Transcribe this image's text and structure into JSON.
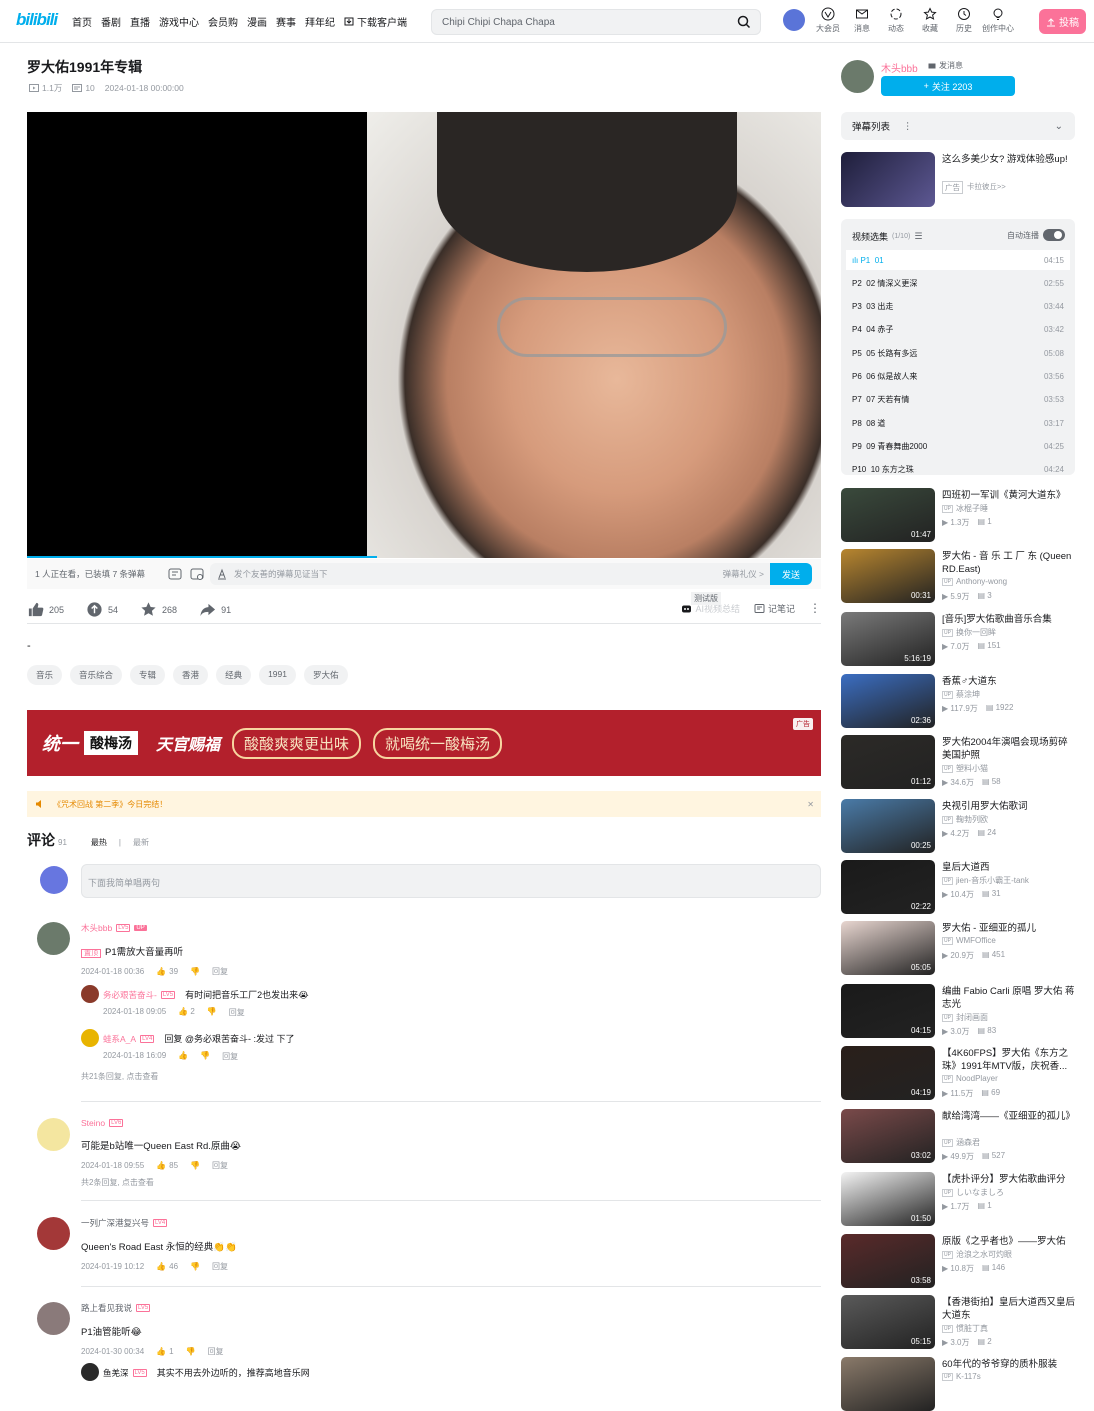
{
  "header": {
    "logo": "bilibili",
    "nav": [
      "首页",
      "番剧",
      "直播",
      "游戏中心",
      "会员购",
      "漫画",
      "赛事",
      "拜年纪"
    ],
    "download": "下载客户端",
    "search_placeholder": "Chipi Chipi Chapa Chapa",
    "icons": [
      {
        "label": "大会员",
        "icon": "vip-icon"
      },
      {
        "label": "消息",
        "icon": "message-icon"
      },
      {
        "label": "动态",
        "icon": "dynamic-icon"
      },
      {
        "label": "收藏",
        "icon": "star-icon"
      },
      {
        "label": "历史",
        "icon": "history-icon"
      },
      {
        "label": "创作中心",
        "icon": "bulb-icon"
      }
    ],
    "upload": "投稿"
  },
  "video": {
    "title": "罗大佑1991年专辑",
    "views": "1.1万",
    "danmaku": "10",
    "date": "2024-01-18 00:00:00",
    "watching": "1 人正在看，已装填 7 条弹幕",
    "danmu_placeholder": "发个友善的弹幕见证当下",
    "danmu_etiquette": "弹幕礼仪 >",
    "send": "发送",
    "likes": "205",
    "coins": "54",
    "favs": "268",
    "shares": "91",
    "ai_summary": "AI视频总结",
    "test_badge": "测试版",
    "notes": "记笔记",
    "desc": "-",
    "tags": [
      "音乐",
      "音乐综合",
      "专辑",
      "香港",
      "经典",
      "1991",
      "罗大佑"
    ]
  },
  "ad": {
    "brand": "统一",
    "product": "酸梅汤",
    "slogan": "天官赐福",
    "line1": "酸酸爽爽更出味",
    "line2": "就喝统一酸梅汤",
    "tag": "广告"
  },
  "notice": "《咒术回战 第二季》今日完结！",
  "comments": {
    "title": "评论",
    "count": "91",
    "sort_hot": "最热",
    "sort_new": "最新",
    "input_placeholder": "下面我简单唱两句",
    "items": [
      {
        "user": "木头bbb",
        "level": "LV5",
        "up": "UP",
        "pinned": "置顶",
        "text": "P1需放大音量再听",
        "date": "2024-01-18 00:36",
        "likes": "39",
        "reply": "回复",
        "subs": [
          {
            "user": "务必艰苦奋斗-",
            "level": "LV5",
            "text": "有时间把音乐工厂2也发出来😭",
            "date": "2024-01-18 09:05",
            "likes": "2",
            "reply": "回复"
          },
          {
            "user": "蛙系A_A",
            "level": "LV4",
            "text": "回复 @务必艰苦奋斗- :发过 下了",
            "date": "2024-01-18 16:09",
            "likes": "",
            "reply": "回复"
          }
        ],
        "more": "共21条回复, 点击查看"
      },
      {
        "user": "Steino",
        "level": "LV6",
        "text": "可能是b站唯一Queen East Rd.原曲😭",
        "date": "2024-01-18 09:55",
        "likes": "85",
        "reply": "回复",
        "more": "共2条回复, 点击查看"
      },
      {
        "user": "一列广深港复兴号",
        "level": "LV4",
        "text": "Queen's Road East 永恒的经典👏👏",
        "date": "2024-01-19 10:12",
        "likes": "46",
        "reply": "回复"
      },
      {
        "user": "路上看见我说",
        "level": "LV5",
        "text": "P1油管能听😂",
        "date": "2024-01-30 00:34",
        "likes": "1",
        "reply": "回复",
        "subs": [
          {
            "user": "鱼羌深",
            "level": "LV5",
            "text": "其实不用去外边听的，推荐高地音乐网",
            "date": "",
            "likes": "",
            "reply": ""
          }
        ]
      }
    ]
  },
  "sidebar": {
    "up_name": "木头bbb",
    "send_msg": "发消息",
    "follow": "关注 2203",
    "danmu_list": "弹幕列表",
    "ad": {
      "title": "这么多美少女? 游戏体验感up!",
      "tag": "广告",
      "sub": "卡拉彼丘>>"
    },
    "collection": {
      "title": "视频选集",
      "progress": "(1/10)",
      "autoplay": "自动连播",
      "episodes": [
        {
          "p": "P1",
          "name": "01",
          "dur": "04:15"
        },
        {
          "p": "P2",
          "name": "02 情深义更深",
          "dur": "02:55"
        },
        {
          "p": "P3",
          "name": "03 出走",
          "dur": "03:44"
        },
        {
          "p": "P4",
          "name": "04 赤子",
          "dur": "03:42"
        },
        {
          "p": "P5",
          "name": "05 长路有多远",
          "dur": "05:08"
        },
        {
          "p": "P6",
          "name": "06 似是故人来",
          "dur": "03:56"
        },
        {
          "p": "P7",
          "name": "07 天若有情",
          "dur": "03:53"
        },
        {
          "p": "P8",
          "name": "08 道",
          "dur": "03:17"
        },
        {
          "p": "P9",
          "name": "09 青春舞曲2000",
          "dur": "04:25"
        },
        {
          "p": "P10",
          "name": "10 东方之珠",
          "dur": "04:24"
        }
      ]
    },
    "recs": [
      {
        "title": "四班初一军训《黄河大道东》",
        "author": "冰棍子睡",
        "views": "1.3万",
        "dm": "1",
        "dur": "01:47",
        "bg": "#3a4a3c"
      },
      {
        "title": "罗大佑 - 音 乐 工 厂 东 (Queen RD.East)",
        "author": "Anthony-wong",
        "views": "5.9万",
        "dm": "3",
        "dur": "00:31",
        "bg": "#b8862f"
      },
      {
        "title": "[音乐]罗大佑歌曲音乐合集",
        "author": "换你一回眸",
        "views": "7.0万",
        "dm": "151",
        "dur": "5:16:19",
        "bg": "#7a7a7a"
      },
      {
        "title": "香蕉♂大道东",
        "author": "蔡涂坤",
        "views": "117.9万",
        "dm": "1922",
        "dur": "02:36",
        "bg": "#3b6ec2"
      },
      {
        "title": "罗大佑2004年演唱会现场剪碎美国护照",
        "author": "塑料小猫",
        "views": "34.6万",
        "dm": "58",
        "dur": "01:12",
        "bg": "#2c2a27"
      },
      {
        "title": "央视引用罗大佑歌词",
        "author": "鞠勃列欧",
        "views": "4.2万",
        "dm": "24",
        "dur": "00:25",
        "bg": "#4a7ba8"
      },
      {
        "title": "皇后大道西",
        "author": "jien-音乐小霸王-tank",
        "views": "10.4万",
        "dm": "31",
        "dur": "02:22",
        "bg": "#1a1a1a"
      },
      {
        "title": "罗大佑 - 亚细亚的孤儿",
        "author": "WMFOffice",
        "views": "20.9万",
        "dm": "451",
        "dur": "05:05",
        "bg": "#e8d6d0"
      },
      {
        "title": "编曲 Fabio Carli 原唱 罗大佑 蒋志光",
        "author": "封闭画面",
        "views": "3.0万",
        "dm": "83",
        "dur": "04:15",
        "bg": "#1a1a1a"
      },
      {
        "title": "【4K60FPS】罗大佑《东方之珠》1991年MTV版，庆祝香...",
        "author": "NoodPlayer",
        "views": "11.5万",
        "dm": "69",
        "dur": "04:19",
        "bg": "#2a1f1a"
      },
      {
        "title": "献给湾湾——《亚细亚的孤儿》",
        "author": "涵森君",
        "views": "49.9万",
        "dm": "527",
        "dur": "03:02",
        "bg": "#7a4a4a"
      },
      {
        "title": "【虎扑评分】罗大佑歌曲评分",
        "author": "しいなましろ",
        "views": "1.7万",
        "dm": "1",
        "dur": "01:50",
        "bg": "#f4f4f4"
      },
      {
        "title": "原版《之乎者也》——罗大佑",
        "author": "沧浪之水可灼眼",
        "views": "10.8万",
        "dm": "146",
        "dur": "03:58",
        "bg": "#5a2a2a"
      },
      {
        "title": "【香港街拍】皇后大道西又皇后大道东",
        "author": "惯脏丁真",
        "views": "3.0万",
        "dm": "2",
        "dur": "05:15",
        "bg": "#5a5a5a"
      },
      {
        "title": "60年代的爷爷穿的质朴服装",
        "author": "K-117s",
        "views": "",
        "dm": "",
        "dur": "",
        "bg": "#8a7a6a"
      }
    ]
  }
}
